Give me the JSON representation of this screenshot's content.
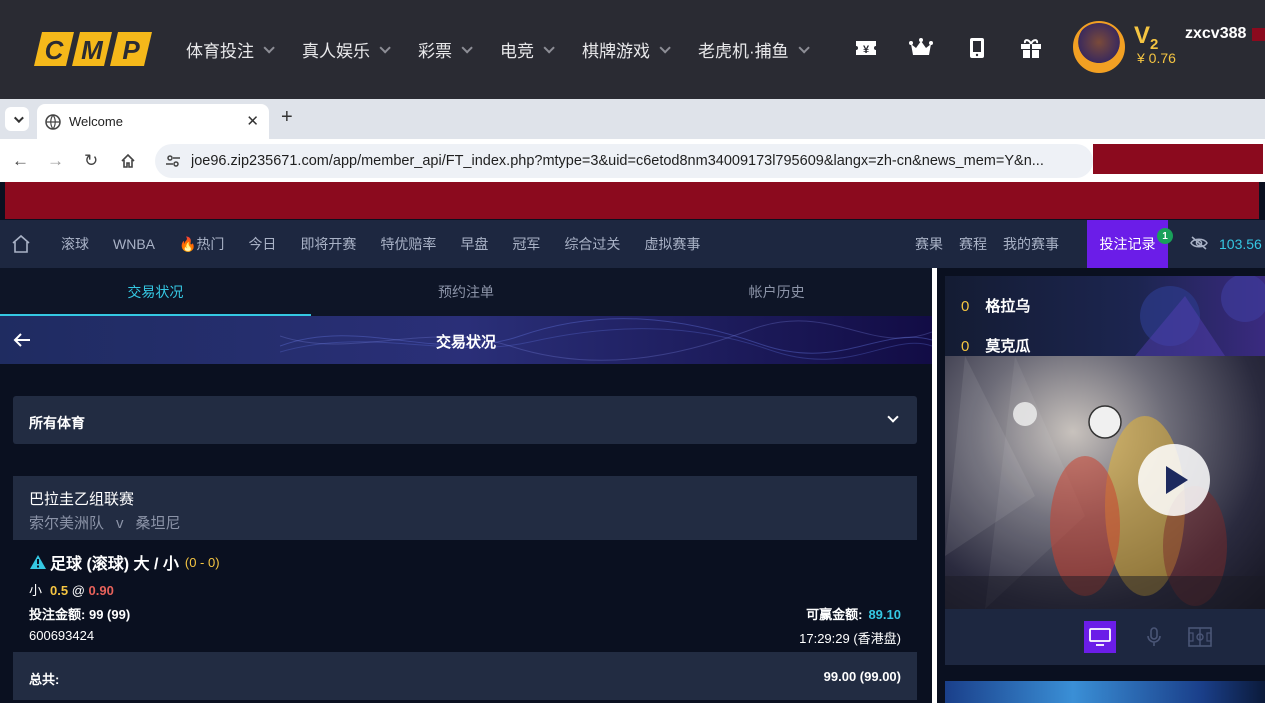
{
  "site": {
    "logo_text": "CMP",
    "nav": [
      {
        "label": "体育投注"
      },
      {
        "label": "真人娱乐"
      },
      {
        "label": "彩票"
      },
      {
        "label": "电竞"
      },
      {
        "label": "棋牌游戏"
      },
      {
        "label": "老虎机·捕鱼"
      }
    ],
    "icons": [
      "ticket-icon",
      "crown-icon",
      "tablet-icon",
      "gift-icon"
    ],
    "vip_level": "V",
    "vip_num": "2",
    "balance": "¥ 0.76",
    "username": "zxcv388"
  },
  "browser": {
    "tab_title": "Welcome",
    "url": "joe96.zip235671.com/app/member_api/FT_index.php?mtype=3&uid=c6etod8nm34009173l795609&langx=zh-cn&news_mem=Y&n..."
  },
  "app_nav": {
    "items": [
      "滚球",
      "WNBA",
      "🔥热门",
      "今日",
      "即将开赛",
      "特优赔率",
      "早盘",
      "冠军",
      "综合过关",
      "虚拟赛事"
    ],
    "right_items": [
      "赛果",
      "赛程",
      "我的赛事"
    ],
    "bets_label": "投注记录",
    "bets_count": "1",
    "wallet": "103.56"
  },
  "subtabs": [
    {
      "label": "交易状况",
      "active": true
    },
    {
      "label": "预约注单",
      "active": false
    },
    {
      "label": "帐户历史",
      "active": false
    }
  ],
  "page": {
    "title": "交易状况",
    "sport_filter": "所有体育"
  },
  "bet": {
    "league": "巴拉圭乙组联赛",
    "home": "索尔美洲队",
    "vs": "v",
    "away": "桑坦尼",
    "market": "足球 (滚球) 大 / 小",
    "score": "(0 - 0)",
    "selection": "小",
    "line": "0.5",
    "at": "@",
    "odds": "0.90",
    "stake_label": "投注金额:",
    "stake": "99 (99)",
    "towin_label": "可赢金额:",
    "towin": "89.10",
    "ticket_id": "600693424",
    "time": "17:29:29 (香港盘)"
  },
  "total": {
    "label": "总共:",
    "value": "99.00 (99.00)"
  },
  "live": {
    "teams": [
      {
        "goals": "0",
        "name": "格拉乌"
      },
      {
        "goals": "0",
        "name": "莫克瓜"
      }
    ]
  },
  "colors": {
    "accent_cyan": "#35c8e3",
    "accent_purple": "#6b1de8",
    "gold": "#f5c542",
    "odds_red": "#e8625b",
    "banner_red": "#8b0a1e"
  }
}
